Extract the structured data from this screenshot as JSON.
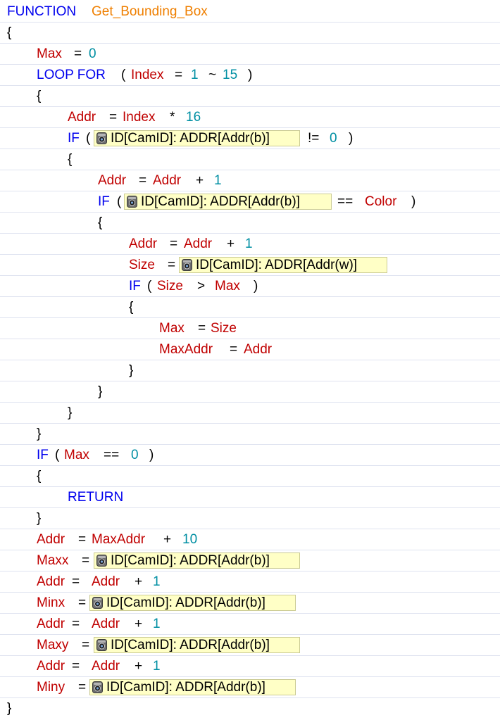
{
  "colors": {
    "keyword": "#0000ee",
    "function_name": "#ef7f00",
    "variable": "#c00000",
    "number": "#008fa3",
    "device_block_bg": "#ffffc6",
    "row_divider": "#dfe3f0"
  },
  "icons": {
    "camera": "camera-icon"
  },
  "lines": [
    {
      "indent": 0,
      "tokens": [
        {
          "t": "kw",
          "v": "FUNCTION"
        },
        {
          "t": "fn",
          "v": "Get_Bounding_Box"
        }
      ]
    },
    {
      "indent": 0,
      "tokens": [
        {
          "t": "pl",
          "v": "{"
        }
      ]
    },
    {
      "indent": 1,
      "tokens": [
        {
          "t": "var",
          "v": "Max"
        },
        {
          "t": "pl",
          "v": "="
        },
        {
          "t": "num",
          "v": "0"
        }
      ]
    },
    {
      "indent": 1,
      "tokens": [
        {
          "t": "kw",
          "v": "LOOP FOR"
        },
        {
          "t": "pl",
          "v": "("
        },
        {
          "t": "var",
          "v": "Index"
        },
        {
          "t": "pl",
          "v": "="
        },
        {
          "t": "num",
          "v": "1"
        },
        {
          "t": "pl",
          "v": "~"
        },
        {
          "t": "num",
          "v": "15"
        },
        {
          "t": "pl",
          "v": ")"
        }
      ]
    },
    {
      "indent": 1,
      "tokens": [
        {
          "t": "pl",
          "v": "{"
        }
      ]
    },
    {
      "indent": 2,
      "tokens": [
        {
          "t": "var",
          "v": "Addr"
        },
        {
          "t": "pl",
          "v": "="
        },
        {
          "t": "var",
          "v": "Index"
        },
        {
          "t": "pl",
          "v": "*"
        },
        {
          "t": "num",
          "v": "16"
        }
      ]
    },
    {
      "indent": 2,
      "tokens": [
        {
          "t": "kw",
          "v": "IF"
        },
        {
          "t": "pl",
          "v": "("
        },
        {
          "t": "cam",
          "v": "ID[CamID]: ADDR[Addr(b)]"
        },
        {
          "t": "pl",
          "v": "!="
        },
        {
          "t": "num",
          "v": "0"
        },
        {
          "t": "pl",
          "v": ")"
        }
      ]
    },
    {
      "indent": 2,
      "tokens": [
        {
          "t": "pl",
          "v": "{"
        }
      ]
    },
    {
      "indent": 3,
      "tokens": [
        {
          "t": "var",
          "v": "Addr"
        },
        {
          "t": "pl",
          "v": "="
        },
        {
          "t": "var",
          "v": "Addr"
        },
        {
          "t": "pl",
          "v": "+"
        },
        {
          "t": "num",
          "v": "1"
        }
      ]
    },
    {
      "indent": 3,
      "tokens": [
        {
          "t": "kw",
          "v": "IF"
        },
        {
          "t": "pl",
          "v": "("
        },
        {
          "t": "cam",
          "v": "ID[CamID]: ADDR[Addr(b)]"
        },
        {
          "t": "pl",
          "v": "=="
        },
        {
          "t": "var",
          "v": "Color"
        },
        {
          "t": "pl",
          "v": ")"
        }
      ]
    },
    {
      "indent": 3,
      "tokens": [
        {
          "t": "pl",
          "v": "{"
        }
      ]
    },
    {
      "indent": 4,
      "tokens": [
        {
          "t": "var",
          "v": "Addr"
        },
        {
          "t": "pl",
          "v": "="
        },
        {
          "t": "var",
          "v": "Addr"
        },
        {
          "t": "pl",
          "v": "+"
        },
        {
          "t": "num",
          "v": "1"
        }
      ]
    },
    {
      "indent": 4,
      "tokens": [
        {
          "t": "var",
          "v": "Size"
        },
        {
          "t": "pl",
          "v": "="
        },
        {
          "t": "cam",
          "v": "ID[CamID]: ADDR[Addr(w)]"
        }
      ]
    },
    {
      "indent": 4,
      "tokens": [
        {
          "t": "kw",
          "v": "IF"
        },
        {
          "t": "pl",
          "v": "("
        },
        {
          "t": "var",
          "v": "Size"
        },
        {
          "t": "pl",
          "v": ">"
        },
        {
          "t": "var",
          "v": "Max"
        },
        {
          "t": "pl",
          "v": ")"
        }
      ]
    },
    {
      "indent": 4,
      "tokens": [
        {
          "t": "pl",
          "v": "{"
        }
      ]
    },
    {
      "indent": 5,
      "tokens": [
        {
          "t": "var",
          "v": "Max"
        },
        {
          "t": "pl",
          "v": "="
        },
        {
          "t": "var",
          "v": "Size"
        }
      ]
    },
    {
      "indent": 5,
      "tokens": [
        {
          "t": "var",
          "v": "MaxAddr"
        },
        {
          "t": "pl",
          "v": "="
        },
        {
          "t": "var",
          "v": "Addr"
        }
      ]
    },
    {
      "indent": 4,
      "tokens": [
        {
          "t": "pl",
          "v": "}"
        }
      ]
    },
    {
      "indent": 3,
      "tokens": [
        {
          "t": "pl",
          "v": "}"
        }
      ]
    },
    {
      "indent": 2,
      "tokens": [
        {
          "t": "pl",
          "v": "}"
        }
      ]
    },
    {
      "indent": 1,
      "tokens": [
        {
          "t": "pl",
          "v": "}"
        }
      ]
    },
    {
      "indent": 1,
      "tokens": [
        {
          "t": "kw",
          "v": "IF"
        },
        {
          "t": "pl",
          "v": "("
        },
        {
          "t": "var",
          "v": "Max"
        },
        {
          "t": "pl",
          "v": "=="
        },
        {
          "t": "num",
          "v": "0"
        },
        {
          "t": "pl",
          "v": ")"
        }
      ]
    },
    {
      "indent": 1,
      "tokens": [
        {
          "t": "pl",
          "v": "{"
        }
      ]
    },
    {
      "indent": 2,
      "tokens": [
        {
          "t": "kw",
          "v": "RETURN"
        }
      ]
    },
    {
      "indent": 1,
      "tokens": [
        {
          "t": "pl",
          "v": "}"
        }
      ]
    },
    {
      "indent": 1,
      "tokens": [
        {
          "t": "var",
          "v": "Addr"
        },
        {
          "t": "pl",
          "v": "="
        },
        {
          "t": "var",
          "v": "MaxAddr"
        },
        {
          "t": "pl",
          "v": "+"
        },
        {
          "t": "num",
          "v": "10"
        }
      ]
    },
    {
      "indent": 1,
      "tokens": [
        {
          "t": "var",
          "v": "Maxx"
        },
        {
          "t": "pl",
          "v": "="
        },
        {
          "t": "cam",
          "v": "ID[CamID]: ADDR[Addr(b)]"
        }
      ]
    },
    {
      "indent": 1,
      "tokens": [
        {
          "t": "var",
          "v": "Addr"
        },
        {
          "t": "pl",
          "v": "="
        },
        {
          "t": "var",
          "v": "Addr"
        },
        {
          "t": "pl",
          "v": "+"
        },
        {
          "t": "num",
          "v": "1"
        }
      ]
    },
    {
      "indent": 1,
      "tokens": [
        {
          "t": "var",
          "v": "Minx"
        },
        {
          "t": "pl",
          "v": "="
        },
        {
          "t": "cam",
          "v": "ID[CamID]: ADDR[Addr(b)]"
        }
      ]
    },
    {
      "indent": 1,
      "tokens": [
        {
          "t": "var",
          "v": "Addr"
        },
        {
          "t": "pl",
          "v": "="
        },
        {
          "t": "var",
          "v": "Addr"
        },
        {
          "t": "pl",
          "v": "+"
        },
        {
          "t": "num",
          "v": "1"
        }
      ]
    },
    {
      "indent": 1,
      "tokens": [
        {
          "t": "var",
          "v": "Maxy"
        },
        {
          "t": "pl",
          "v": "="
        },
        {
          "t": "cam",
          "v": "ID[CamID]: ADDR[Addr(b)]"
        }
      ]
    },
    {
      "indent": 1,
      "tokens": [
        {
          "t": "var",
          "v": "Addr"
        },
        {
          "t": "pl",
          "v": "="
        },
        {
          "t": "var",
          "v": "Addr"
        },
        {
          "t": "pl",
          "v": "+"
        },
        {
          "t": "num",
          "v": "1"
        }
      ]
    },
    {
      "indent": 1,
      "tokens": [
        {
          "t": "var",
          "v": "Miny"
        },
        {
          "t": "pl",
          "v": "="
        },
        {
          "t": "cam",
          "v": "ID[CamID]: ADDR[Addr(b)]"
        }
      ]
    },
    {
      "indent": 0,
      "tokens": [
        {
          "t": "pl",
          "v": "}"
        }
      ]
    }
  ]
}
